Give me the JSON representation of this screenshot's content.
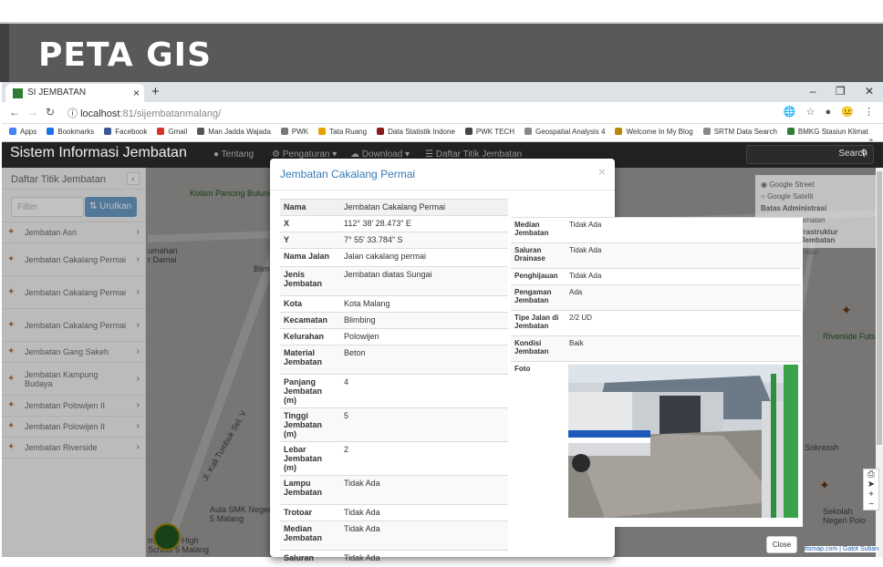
{
  "slide_title": "PETA GIS",
  "browser": {
    "tab_title": "SI JEMBATAN",
    "tab_close": "×",
    "new_tab": "+",
    "window_controls": "–  ❐  ✕",
    "url_host": "localhost",
    "url_path": ":81/sijembatanmalang/",
    "bookmarks": [
      {
        "label": "Apps",
        "color": "#4285f4"
      },
      {
        "label": "Bookmarks",
        "color": "#1a73e8"
      },
      {
        "label": "Facebook",
        "color": "#3b5998"
      },
      {
        "label": "Gmail",
        "color": "#d93025"
      },
      {
        "label": "Man Jadda Wajada",
        "color": "#555555"
      },
      {
        "label": "PWK",
        "color": "#777777"
      },
      {
        "label": "Tata Ruang",
        "color": "#e8a000"
      },
      {
        "label": "Data Statistik Indone",
        "color": "#8b1a1a"
      },
      {
        "label": "PWK TECH",
        "color": "#444444"
      },
      {
        "label": "Geospatial Analysis 4",
        "color": "#888888"
      },
      {
        "label": "Welcome In My Blog",
        "color": "#b8860b"
      },
      {
        "label": "SRTM Data Search",
        "color": "#888888"
      },
      {
        "label": "BMKG Stasiun Klimat",
        "color": "#2e7d32"
      }
    ],
    "bookmarks_more": "»"
  },
  "navbar": {
    "brand": "Sistem Informasi Jembatan",
    "items": [
      "Tentang",
      "Pengaturan ▾",
      "Download ▾",
      "Daftar Titik Jembatan"
    ],
    "search_placeholder": "Search",
    "search_icon": "search-icon"
  },
  "sidebar": {
    "title": "Daftar Titik Jembatan",
    "collapse_icon": "‹",
    "filter_placeholder": "Filter",
    "sort_label": "⇅ Urutkan",
    "items": [
      "Jembatan Asri",
      "Jembatan Cakalang Permai",
      "Jembatan Cakalang Permai",
      "Jembatan Cakalang Permai",
      "Jembatan Gang Sakeh",
      "Jembatan Kampung Budaya",
      "Jembatan Polowijen II",
      "Jembatan Polowijen II",
      "Jembatan Riverside"
    ]
  },
  "layers_panel": {
    "options": [
      "Google Street",
      "Google Satelit"
    ],
    "section": "Batas Administrasi",
    "extra": [
      "amatan",
      "frastruktur Jembatan",
      "natan"
    ]
  },
  "map_labels": {
    "kolam": "Kolam Pancing Bulurejo",
    "umahan": "umahan",
    "dami": "r Damai",
    "blim": "Blimb",
    "riverside": "Riverside Futsa",
    "sokressh": "Sokressh",
    "aula": "Aula SMK Negeri 5 Malang",
    "national": "rnational High School 5 Malang",
    "sekolah": "Sekolah Negeri Polo",
    "jalan": "Jl. Kali Tumbuk Sel. V",
    "attribution": "ttsmap.com | Gatot Suban"
  },
  "modal": {
    "title": "Jembatan Cakalang Permai",
    "close": "×",
    "left_fields": [
      {
        "key": "Nama",
        "value": "Jembatan Cakalang Permai"
      },
      {
        "key": "X",
        "value": "112° 38' 28.473\" E"
      },
      {
        "key": "Y",
        "value": "7° 55' 33.784\" S"
      },
      {
        "key": "Nama Jalan",
        "value": "Jalan cakalang permai"
      },
      {
        "key": "Jenis Jembatan",
        "value": "Jembatan diatas Sungai"
      },
      {
        "key": "Kota",
        "value": "Kota Malang"
      },
      {
        "key": "Kecamatan",
        "value": "Blimbing"
      },
      {
        "key": "Kelurahan",
        "value": "Polowijen"
      },
      {
        "key": "Material Jembatan",
        "value": "Beton"
      },
      {
        "key": "Panjang Jembatan (m)",
        "value": "4"
      },
      {
        "key": "Tinggi Jembatan (m)",
        "value": "5"
      },
      {
        "key": "Lebar Jembatan (m)",
        "value": "2"
      },
      {
        "key": "Lampu Jembatan",
        "value": "Tidak Ada"
      },
      {
        "key": "Trotoar",
        "value": "Tidak Ada"
      },
      {
        "key": "Median Jembatan",
        "value": "Tidak Ada"
      },
      {
        "key": "Saluran",
        "value": "Tidak Ada"
      }
    ],
    "right_fields": [
      {
        "key": "Median Jembatan",
        "value": "Tidak Ada"
      },
      {
        "key": "Saluran Drainase",
        "value": "Tidak Ada"
      },
      {
        "key": "Penghijauan",
        "value": "Tidak Ada"
      },
      {
        "key": "Pengaman Jembatan",
        "value": "Ada"
      },
      {
        "key": "Tipe Jalan di Jembatan",
        "value": "2/2 UD"
      },
      {
        "key": "Kondisi Jembatan",
        "value": "Baik"
      },
      {
        "key": "Foto",
        "value": ""
      }
    ],
    "close_button": "Close"
  }
}
